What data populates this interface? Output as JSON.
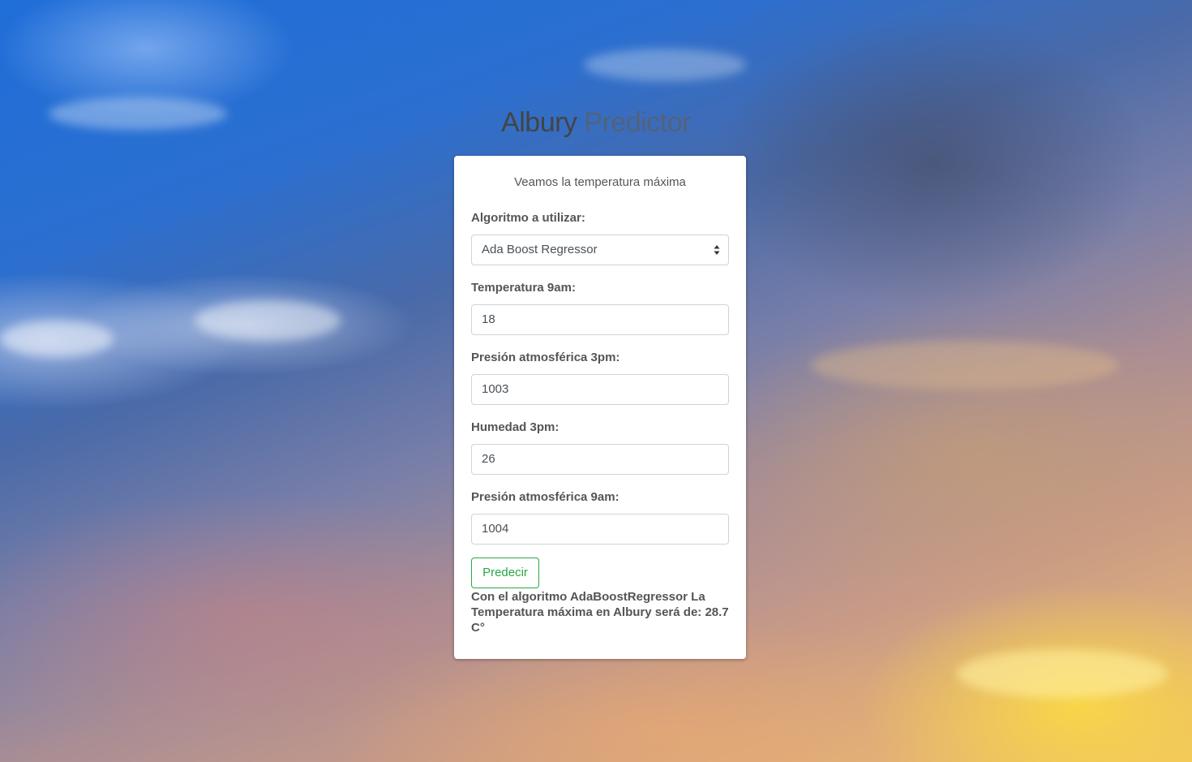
{
  "header": {
    "title_part1": "Albury",
    "title_part2": "Predictor"
  },
  "card": {
    "subtitle": "Veamos la temperatura máxima",
    "algorithm": {
      "label": "Algoritmo a utilizar:",
      "selected": "Ada Boost Regressor"
    },
    "temp9am": {
      "label": "Temperatura 9am:",
      "value": "18"
    },
    "pressure3pm": {
      "label": "Presión atmosférica 3pm:",
      "value": "1003"
    },
    "humidity3pm": {
      "label": "Humedad 3pm:",
      "value": "26"
    },
    "pressure9am": {
      "label": "Presión atmosférica 9am:",
      "value": "1004"
    },
    "submit_label": "Predecir",
    "result_text": "Con el algoritmo AdaBoostRegressor La Temperatura máxima en Albury será de: 28.7 C°"
  },
  "colors": {
    "accent_green": "#28a745",
    "text_gray": "#555555"
  },
  "icons": {
    "select_arrows": "chevron-up-down-icon"
  }
}
